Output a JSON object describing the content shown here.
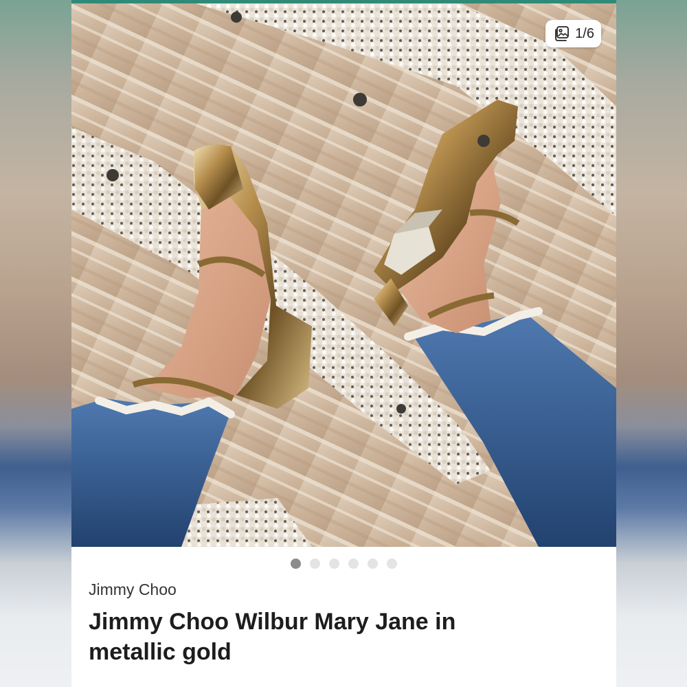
{
  "image_counter": {
    "icon": "image-gallery-icon",
    "text": "1/6"
  },
  "carousel": {
    "total": 6,
    "active_index": 0
  },
  "listing": {
    "brand": "Jimmy Choo",
    "title": "Jimmy Choo Wilbur Mary Jane in metallic gold"
  },
  "colors": {
    "accent_strip": "#2f8a78",
    "dot_active": "#8c8c8c",
    "dot_inactive": "#e4e4e4"
  }
}
